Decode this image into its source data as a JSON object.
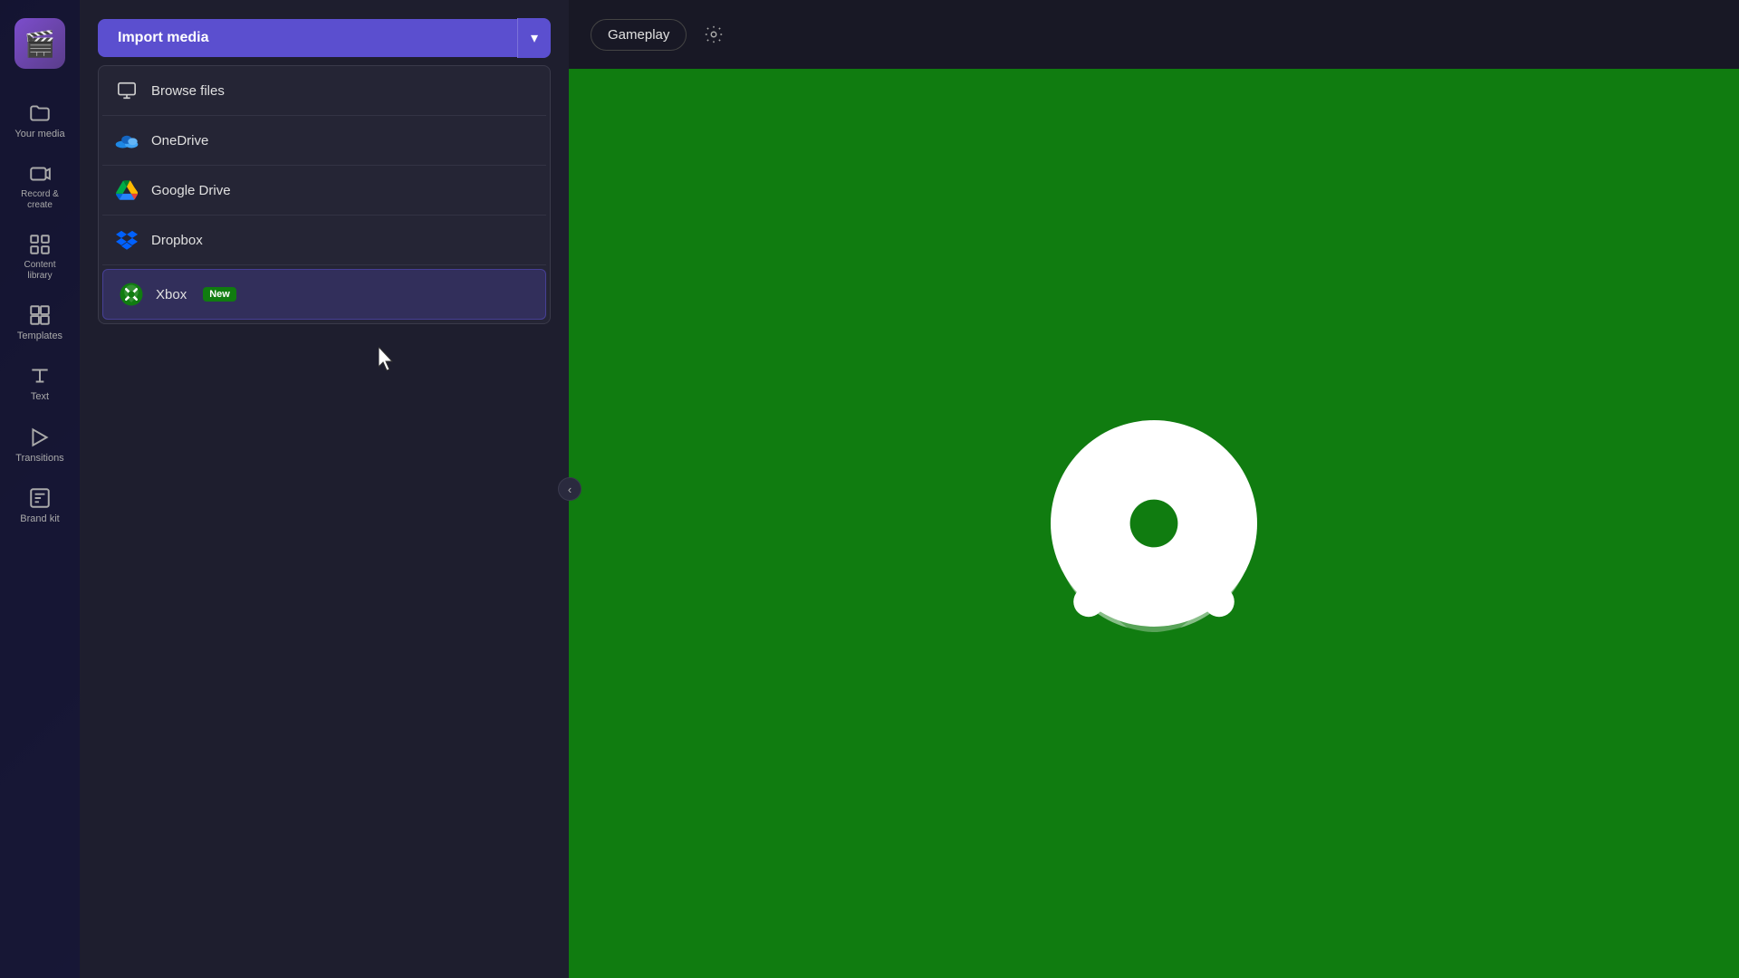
{
  "app": {
    "logo": "🎬"
  },
  "sidebar": {
    "items": [
      {
        "id": "your-media",
        "label": "Your media",
        "icon": "folder"
      },
      {
        "id": "record-create",
        "label": "Record &\ncreate",
        "icon": "record"
      },
      {
        "id": "content-library",
        "label": "Content\nlibrary",
        "icon": "grid"
      },
      {
        "id": "templates",
        "label": "Templates",
        "icon": "templates"
      },
      {
        "id": "text",
        "label": "Text",
        "icon": "text"
      },
      {
        "id": "transitions",
        "label": "Transitions",
        "icon": "transitions"
      },
      {
        "id": "brand-kit",
        "label": "Brand kit",
        "icon": "brand"
      }
    ]
  },
  "import_button": {
    "label": "Import media",
    "chevron": "▾"
  },
  "dropdown": {
    "items": [
      {
        "id": "browse-files",
        "label": "Browse files",
        "icon": "monitor"
      },
      {
        "id": "onedrive",
        "label": "OneDrive",
        "icon": "onedrive"
      },
      {
        "id": "google-drive",
        "label": "Google Drive",
        "icon": "gdrive"
      },
      {
        "id": "dropbox",
        "label": "Dropbox",
        "icon": "dropbox"
      },
      {
        "id": "xbox",
        "label": "Xbox",
        "badge": "New",
        "icon": "xbox",
        "highlighted": true
      }
    ]
  },
  "header": {
    "gameplay_label": "Gameplay",
    "settings_icon": "⚙"
  },
  "preview": {
    "background_color": "#107c10"
  }
}
